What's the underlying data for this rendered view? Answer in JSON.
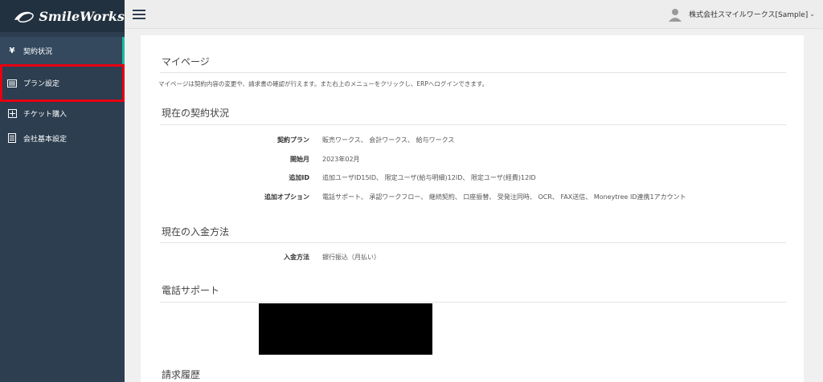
{
  "sidebar": {
    "brand": "SmileWorks",
    "items": [
      {
        "label": "契約状況",
        "icon": "yen-icon"
      },
      {
        "label": "プラン設定",
        "icon": "list-icon"
      },
      {
        "label": "チケット購入",
        "icon": "plus-box-icon"
      },
      {
        "label": "会社基本設定",
        "icon": "document-icon"
      }
    ]
  },
  "header": {
    "company": "株式会社スマイルワークス[Sample]",
    "caret": "⌄"
  },
  "mypage": {
    "title": "マイページ",
    "description": "マイページは契約内容の変更や、請求書の確認が行えます。また右上のメニューをクリックし、ERPへログインできます。"
  },
  "contract": {
    "title": "現在の契約状況",
    "rows": [
      {
        "label": "契約プラン",
        "value": "販売ワークス、 会計ワークス、 給与ワークス"
      },
      {
        "label": "開始月",
        "value": "2023年02月"
      },
      {
        "label": "追加ID",
        "value": "追加ユーザID15ID、 限定ユーザ(給与明細)12ID、 限定ユーザ(経費)12ID"
      },
      {
        "label": "追加オプション",
        "value": "電話サポート、 承認ワークフロー、 継続契約、 口座振替、 受発注同時、 OCR、 FAX送信、 Moneytree ID連携1アカウント"
      }
    ]
  },
  "payment": {
    "title": "現在の入金方法",
    "rows": [
      {
        "label": "入金方法",
        "value": "銀行振込（月払い）"
      }
    ]
  },
  "support": {
    "title": "電話サポート"
  },
  "billing": {
    "title": "請求履歴"
  },
  "colors": {
    "sidebar_bg": "#2c3e50",
    "accent": "#1abc9c",
    "highlight": "#e60012"
  }
}
